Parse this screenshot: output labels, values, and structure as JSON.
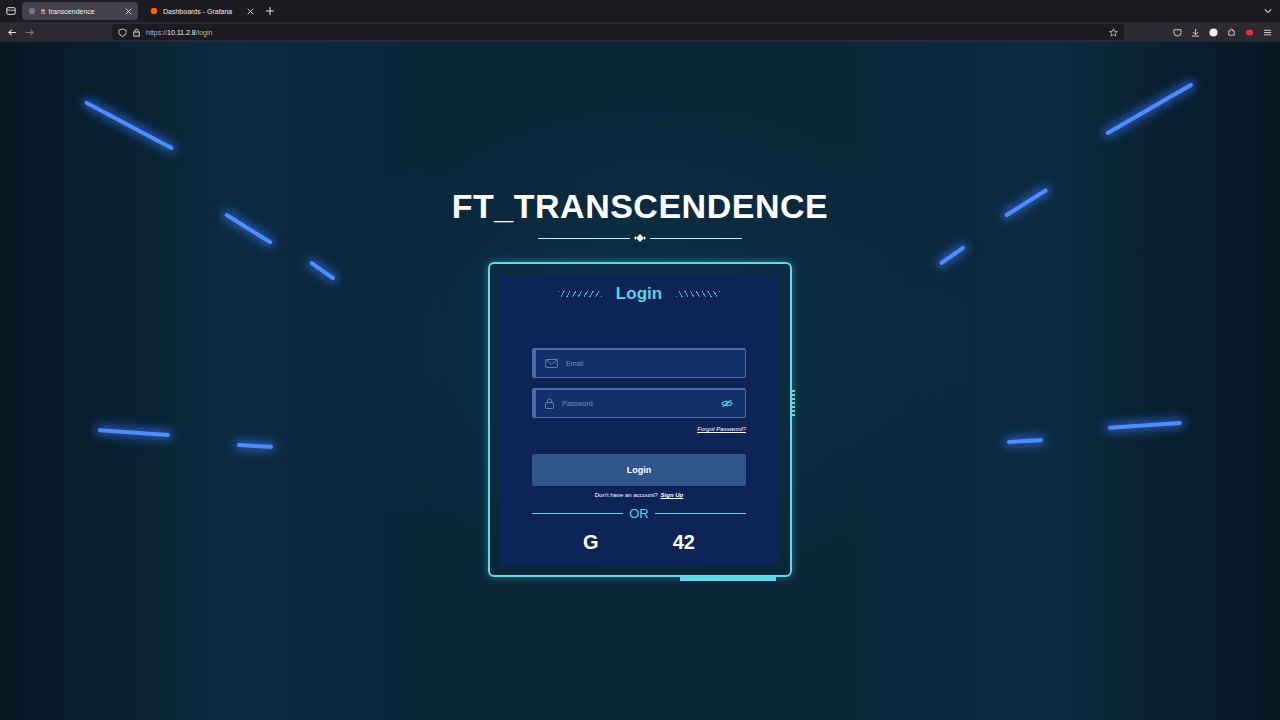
{
  "browser": {
    "tabs": [
      {
        "label": "ft_transcendence",
        "selected": true
      },
      {
        "label": "Dashboards - Grafana",
        "selected": false
      }
    ],
    "address": {
      "prefix": "https://",
      "host": "10.11.2.8",
      "path": "/login"
    }
  },
  "page": {
    "title": "FT_TRANSCENDENCE",
    "login_card": {
      "heading": "Login",
      "fields": [
        {
          "placeholder": "Email",
          "kind": "email"
        },
        {
          "placeholder": "Password",
          "kind": "password"
        }
      ],
      "forgot_link": "Forgot Password?",
      "submit_button": "Login",
      "signup_prompt": "Don't have an account?",
      "signup_link": "Sign Up",
      "divider": "OR",
      "oauth_buttons": [
        {
          "label": "G"
        },
        {
          "label": "42"
        }
      ]
    }
  }
}
